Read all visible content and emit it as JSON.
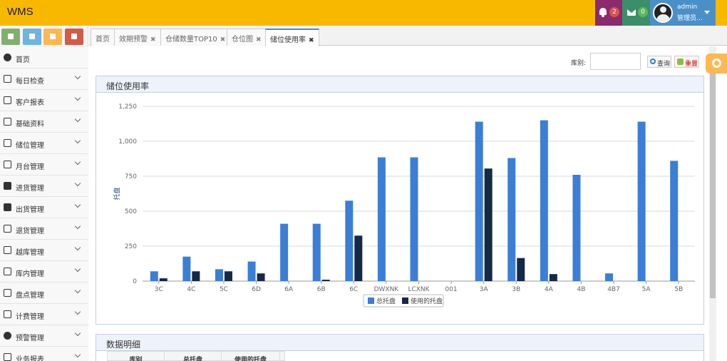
{
  "app": {
    "title": "WMS"
  },
  "header": {
    "notifications_count": "2",
    "messages_count": "0",
    "user_name": "admin",
    "user_role": "管理员..."
  },
  "sidebar": {
    "items": [
      {
        "label": "首页",
        "icon": "dashboard-icon"
      },
      {
        "label": "每日检查",
        "icon": "list-icon"
      },
      {
        "label": "客户报表",
        "icon": "list-icon"
      },
      {
        "label": "基础资料",
        "icon": "file-icon"
      },
      {
        "label": "储位管理",
        "icon": "building-icon"
      },
      {
        "label": "月台管理",
        "icon": "list-ul-icon"
      },
      {
        "label": "进货管理",
        "icon": "check-square-icon"
      },
      {
        "label": "出货管理",
        "icon": "truck-icon"
      },
      {
        "label": "退货管理",
        "icon": "list-icon"
      },
      {
        "label": "越库管理",
        "icon": "list-icon"
      },
      {
        "label": "库内管理",
        "icon": "film-icon"
      },
      {
        "label": "盘点管理",
        "icon": "list-icon"
      },
      {
        "label": "计费管理",
        "icon": "list-icon"
      },
      {
        "label": "预警管理",
        "icon": "volume-icon"
      },
      {
        "label": "业务报表",
        "icon": "list-icon"
      }
    ]
  },
  "tabs": [
    {
      "label": "首页",
      "closable": false
    },
    {
      "label": "效期预警",
      "closable": true
    },
    {
      "label": "仓储数量TOP10",
      "closable": true
    },
    {
      "label": "仓位图",
      "closable": true
    },
    {
      "label": "储位使用率",
      "closable": true,
      "active": true
    }
  ],
  "filter": {
    "warehouse_label": "库别:",
    "warehouse_value": "",
    "search_label": "查询",
    "reset_label": "重置"
  },
  "panel_chart": {
    "title": "储位使用率"
  },
  "panel_detail": {
    "title": "数据明细",
    "columns": [
      "库别",
      "总托盘",
      "使用的托盘"
    ]
  },
  "chart_data": {
    "type": "bar",
    "title": "",
    "xlabel": "",
    "ylabel": "托盘",
    "ylim": [
      0,
      1250
    ],
    "yticks": [
      0,
      250,
      500,
      750,
      1000,
      1250
    ],
    "ytick_labels": [
      "0",
      "250",
      "500",
      "750",
      "1,000",
      "1,250"
    ],
    "grid": true,
    "legend_position": "bottom",
    "categories": [
      "3C",
      "4C",
      "5C",
      "6D",
      "6A",
      "6B",
      "6C",
      "DWXNK",
      "LCXNK",
      "001",
      "3A",
      "3B",
      "4A",
      "4B",
      "4B7",
      "5A",
      "5B"
    ],
    "series": [
      {
        "name": "总托盘",
        "color": "#3a7fd5",
        "values": [
          70,
          175,
          85,
          140,
          410,
          410,
          575,
          885,
          885,
          0,
          1140,
          880,
          1150,
          760,
          55,
          1140,
          860
        ]
      },
      {
        "name": "使用的托盘",
        "color": "#142945",
        "values": [
          20,
          70,
          70,
          55,
          0,
          10,
          325,
          0,
          0,
          0,
          805,
          165,
          50,
          0,
          0,
          0,
          0
        ]
      }
    ]
  }
}
